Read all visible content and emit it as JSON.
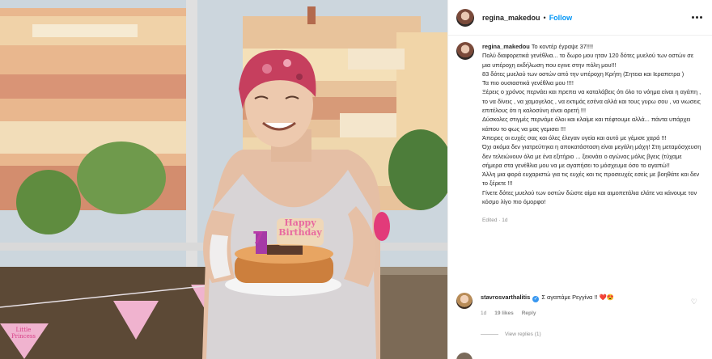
{
  "post_header": {
    "username": "regina_makedou",
    "separator": "•",
    "follow_label": "Follow",
    "more_icon": "more-options-icon"
  },
  "photo": {
    "cake_topper": "Happy Birthday",
    "candle_number": "7",
    "flag_text_left": "Little Princess",
    "description_icon": "photo"
  },
  "caption": {
    "author": "regina_makedou",
    "lines": [
      "Το κοντέρ έγραψε 37!!!!",
      "Πολύ διαφορετικά γενέθλια... το δωρο μου ηταν 120 δότες μυελού των οστών σε μια υπέροχη εκδήλωση που εγινε στην πόλη μου!!!",
      "83 δότες μυελού των οστών από την υπέροχη Κρήτη (Σητεια και Ιεραπετρα )",
      "Τα πιο ουσιαστικά γενέθλια μου !!!!",
      "Ξέρεις ο χρόνος περνάει και πρεπει να καταλάβεις ότι όλο το νόημα είναι η αγάπη , το να δίνεις , να χαμογελας , να εκτιμάς εσένα αλλά και τους γυρω σου , να νιωσεις επιτέλους ότι η καλοσύνη είναι αρετή !!!",
      "Δύσκολες στιγμές περνάμε όλοι και κλαίμε και πέφτουμε αλλά... πάντα υπάρχει κάπου το φως να μας γεμισει !!!",
      "Άπειρες οι ευχές σας και όλες έλεγαν υγεία και αυτό με γέμισε χαρά !!!",
      "Όχι ακόμα δεν γιατρεύτηκα η αποκατάσταση είναι μεγάλη μάχη! Στη μεταμόσχευση δεν τελειώνουν όλα με ένα εξιτήριο ... ξεκινάει ο αγώνας μόλις βγεις (τύχαμε σήμερα στα γενέθλια μου να με αγαπήσει το μόσχευμα όσο το αγαπώ!!",
      "Άλλη μια φορά ευχαριστώ για τις ευχές και τις προσευχές εσείς με βοηθάτε και δεν το ξέρετε !!!",
      "Γίνετε δότες μυελού των οστών δώστε αίμα και αιμοπετάλια ελάτε να κάνουμε τον κόσμο λίγο πιο όμορφο!"
    ],
    "meta": "Edited · 1d"
  },
  "comment": {
    "author": "stavrosvarthalitis",
    "verified_icon": "verified-badge-icon",
    "text": "Σ αγαπάμε Ρεγγίνα !! ❤️😍",
    "time": "1d",
    "likes": "19 likes",
    "reply_label": "Reply",
    "view_replies": "View replies (1)",
    "heart_icon": "heart-outline-icon"
  }
}
